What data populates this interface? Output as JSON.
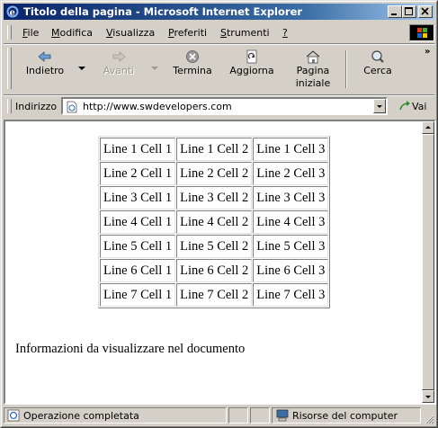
{
  "window": {
    "title": "Titolo della pagina - Microsoft Internet Explorer"
  },
  "menubar": {
    "items": [
      {
        "label": "File",
        "accel": "F"
      },
      {
        "label": "Modifica",
        "accel": "M"
      },
      {
        "label": "Visualizza",
        "accel": "V"
      },
      {
        "label": "Preferiti",
        "accel": "P"
      },
      {
        "label": "Strumenti",
        "accel": "S"
      },
      {
        "label": "?",
        "accel": "?"
      }
    ]
  },
  "toolbar": {
    "back_label": "Indietro",
    "forward_label": "Avanti",
    "stop_label": "Termina",
    "refresh_label": "Aggiorna",
    "home_label_line1": "Pagina",
    "home_label_line2": "iniziale",
    "search_label": "Cerca",
    "more": "»"
  },
  "addressbar": {
    "label": "Indirizzo",
    "url": "http://www.swdevelopers.com",
    "go_label": "Vai"
  },
  "page": {
    "table": [
      [
        "Line 1 Cell 1",
        "Line 1 Cell 2",
        "Line 1 Cell 3"
      ],
      [
        "Line 2 Cell 1",
        "Line 2 Cell 2",
        "Line 2 Cell 3"
      ],
      [
        "Line 3 Cell 1",
        "Line 3 Cell 2",
        "Line 3 Cell 3"
      ],
      [
        "Line 4 Cell 1",
        "Line 4 Cell 2",
        "Line 4 Cell 3"
      ],
      [
        "Line 5 Cell 1",
        "Line 5 Cell 2",
        "Line 5 Cell 3"
      ],
      [
        "Line 6 Cell 1",
        "Line 6 Cell 2",
        "Line 6 Cell 3"
      ],
      [
        "Line 7 Cell 1",
        "Line 7 Cell 2",
        "Line 7 Cell 3"
      ]
    ],
    "text": "Informazioni da visualizzare nel documento"
  },
  "statusbar": {
    "status": "Operazione completata",
    "zone": "Risorse del computer"
  },
  "colors": {
    "titlebar_start": "#0a246a",
    "titlebar_end": "#a6caf0",
    "chrome": "#d4d0c8"
  }
}
